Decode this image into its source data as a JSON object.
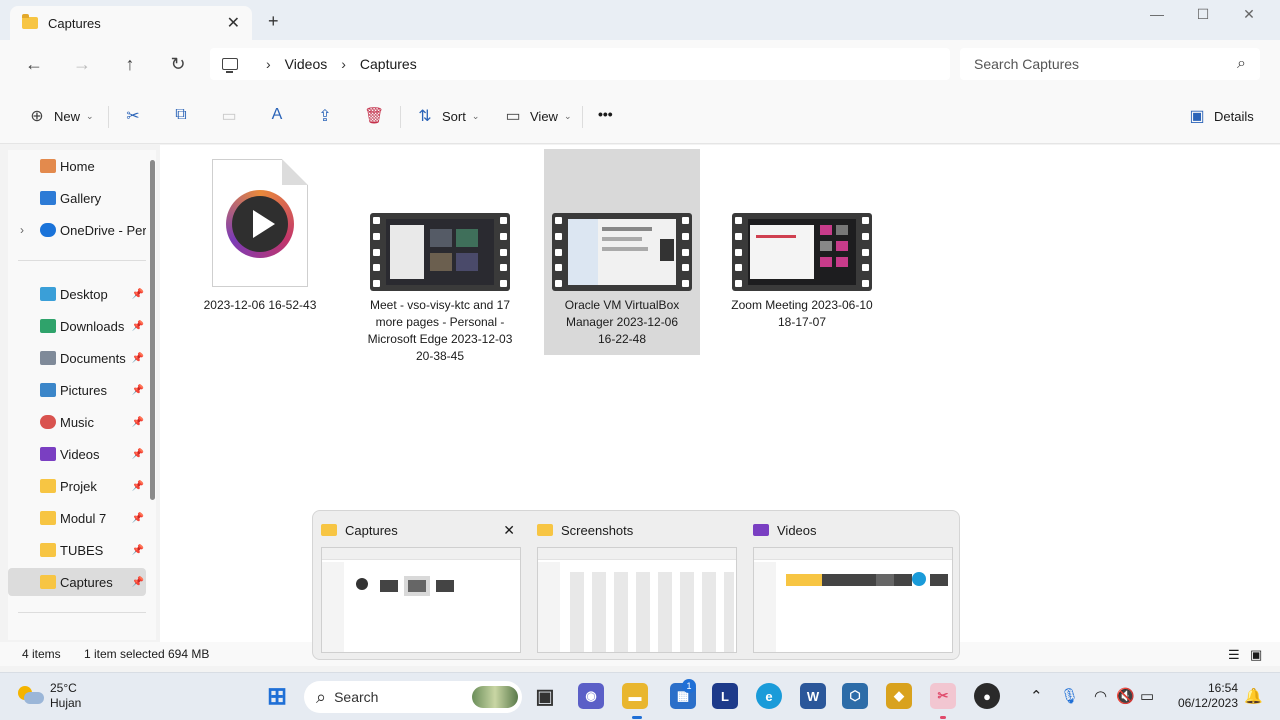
{
  "window": {
    "tab_title": "Captures",
    "tab_close": "✕",
    "new_tab": "+",
    "minimize": "—",
    "maximize": "☐",
    "close": "✕"
  },
  "nav": {
    "back": "←",
    "forward": "→",
    "up": "↑",
    "refresh": "↻",
    "breadcrumb": [
      "Videos",
      "Captures"
    ],
    "chevron": "›",
    "search_placeholder": "Search Captures",
    "search_icon": "⌕"
  },
  "commands": {
    "new": "New",
    "sort": "Sort",
    "view": "View",
    "more": "•••",
    "details": "Details",
    "icons": {
      "new": "⊕",
      "cut": "✂",
      "copy": "⧉",
      "paste": "▭",
      "rename": "A",
      "share": "⇪",
      "delete": "🗑",
      "sort": "⇅",
      "view": "▭",
      "details": "▣"
    },
    "chevron": "⌄"
  },
  "sidebar": {
    "pin": "📌",
    "expand": "›",
    "items": [
      {
        "label": "Home",
        "color": "#e38a4d"
      },
      {
        "label": "Gallery",
        "color": "#2d7bd6"
      },
      {
        "label": "OneDrive - Personal",
        "color": "#1a73d9"
      },
      {
        "label": "Desktop",
        "color": "#3a9fd8"
      },
      {
        "label": "Downloads",
        "color": "#2fa36b"
      },
      {
        "label": "Documents",
        "color": "#7f8a99"
      },
      {
        "label": "Pictures",
        "color": "#3b86c9"
      },
      {
        "label": "Music",
        "color": "#d9534f"
      },
      {
        "label": "Videos",
        "color": "#7a3fc2"
      },
      {
        "label": "Projek",
        "color": "#f7c543"
      },
      {
        "label": "Modul 7",
        "color": "#f7c543"
      },
      {
        "label": "TUBES",
        "color": "#f7c543"
      },
      {
        "label": "Captures",
        "color": "#f7c543"
      }
    ]
  },
  "files": [
    {
      "name": "2023-12-06 16-52-43",
      "kind": "media"
    },
    {
      "name": "Meet - vso-visy-ktc and 17 more pages - Personal - Microsoft Edge 2023-12-03 20-38-45",
      "kind": "video"
    },
    {
      "name": "Oracle VM VirtualBox Manager 2023-12-06 16-22-48",
      "kind": "video"
    },
    {
      "name": "Zoom Meeting 2023-06-10 18-17-07",
      "kind": "video"
    }
  ],
  "status": {
    "count": "4 items",
    "selection": "1 item selected",
    "size": "694 MB"
  },
  "popup": {
    "thumbs": [
      {
        "title": "Captures",
        "color": "#f7c543",
        "close": "✕"
      },
      {
        "title": "Screenshots",
        "color": "#f7c543"
      },
      {
        "title": "Videos",
        "color": "#7a3fc2"
      }
    ]
  },
  "taskbar": {
    "temperature": "25°C",
    "weather": "Hujan",
    "search": "Search",
    "search_icon": "⌕",
    "badge": "1",
    "apps": [
      {
        "name": "start",
        "glyph": "⊞",
        "color": "#1f6fd6"
      },
      {
        "name": "task-view",
        "glyph": "▣",
        "color": "#333333"
      },
      {
        "name": "teams",
        "glyph": "◉",
        "color": "#5b5fc7"
      },
      {
        "name": "file-explorer",
        "glyph": "▬",
        "color": "#e9b62f"
      },
      {
        "name": "store",
        "glyph": "▦",
        "color": "#2b6fc9"
      },
      {
        "name": "app-l",
        "glyph": "L",
        "color": "#1d3a8a"
      },
      {
        "name": "edge",
        "glyph": "e",
        "color": "#1a9bd9"
      },
      {
        "name": "word",
        "glyph": "W",
        "color": "#2b579a"
      },
      {
        "name": "virtualbox",
        "glyph": "⬡",
        "color": "#2d6ca8"
      },
      {
        "name": "app-64",
        "glyph": "◆",
        "color": "#d9a21e"
      },
      {
        "name": "snipping",
        "glyph": "✂",
        "color": "#e04a6b"
      },
      {
        "name": "obs",
        "glyph": "●",
        "color": "#2a2a2a"
      }
    ],
    "tray": {
      "chevron": "⌃",
      "mic": "🎙",
      "wifi": "◠",
      "volume": "🔇",
      "battery": "▭",
      "bell": "🔔"
    },
    "time": "16:54",
    "date": "06/12/2023"
  }
}
